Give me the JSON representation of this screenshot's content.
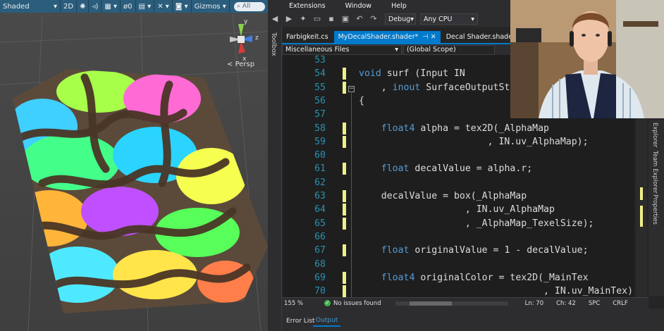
{
  "unity": {
    "shading_mode": "Shaded",
    "toggle_2d": "2D",
    "hidden_count": "0",
    "gizmos_label": "Gizmos",
    "search_placeholder": "All",
    "axis_y": "y",
    "axis_z": "z",
    "axis_x": "x",
    "persp_label": "Persp"
  },
  "vs": {
    "menu": [
      "Extensions",
      "Window",
      "Help"
    ],
    "config": "Debug",
    "platform": "Any CPU",
    "toolbox_label": "Toolbox",
    "tabs": [
      {
        "label": "Farbigkeit.cs",
        "active": false
      },
      {
        "label": "MyDecalShader.shader*",
        "active": true
      },
      {
        "label": "Decal Shader.shader",
        "active": false
      }
    ],
    "nav_project": "Miscellaneous Files",
    "nav_scope": "(Global Scope)",
    "code": [
      {
        "n": "53",
        "t": "",
        "chg": false
      },
      {
        "n": "54",
        "t": "void surf (Input IN",
        "chg": true
      },
      {
        "n": "55",
        "t": "    , inout SurfaceOutputSt",
        "chg": true
      },
      {
        "n": "56",
        "t": "{",
        "chg": false
      },
      {
        "n": "57",
        "t": "",
        "chg": false
      },
      {
        "n": "58",
        "t": "    float4 alpha = tex2D(_AlphaMap",
        "chg": true
      },
      {
        "n": "59",
        "t": "                       , IN.uv_AlphaMap);",
        "chg": true
      },
      {
        "n": "60",
        "t": "",
        "chg": false
      },
      {
        "n": "61",
        "t": "    float decalValue = alpha.r;",
        "chg": true
      },
      {
        "n": "62",
        "t": "",
        "chg": false
      },
      {
        "n": "63",
        "t": "    decalValue = box(_AlphaMap",
        "chg": true
      },
      {
        "n": "64",
        "t": "                   , IN.uv_AlphaMap",
        "chg": true
      },
      {
        "n": "65",
        "t": "                   , _AlphaMap_TexelSize);",
        "chg": true
      },
      {
        "n": "66",
        "t": "",
        "chg": false
      },
      {
        "n": "67",
        "t": "    float originalValue = 1 - decalValue;",
        "chg": true
      },
      {
        "n": "68",
        "t": "",
        "chg": false
      },
      {
        "n": "69",
        "t": "    float4 originalColor = tex2D(_MainTex",
        "chg": true
      },
      {
        "n": "70",
        "t": "                                 , IN.uv_MainTex)",
        "chg": true
      }
    ],
    "status": {
      "zoom": "155 %",
      "issues": "No issues found",
      "line": "Ln: 70",
      "col": "Ch: 42",
      "spc": "SPC",
      "crlf": "CRLF"
    },
    "right_tabs": [
      "Explorer",
      "Team Explorer",
      "Properties"
    ],
    "bottom_tabs": [
      {
        "label": "Error List",
        "active": false
      },
      {
        "label": "Output",
        "active": true
      }
    ]
  },
  "colors": {
    "vs_accent": "#007acc",
    "keyword": "#569cd6",
    "line_number": "#2b91af",
    "change_marker": "#efef88",
    "unity_toolbar": "#2b5d7c"
  }
}
